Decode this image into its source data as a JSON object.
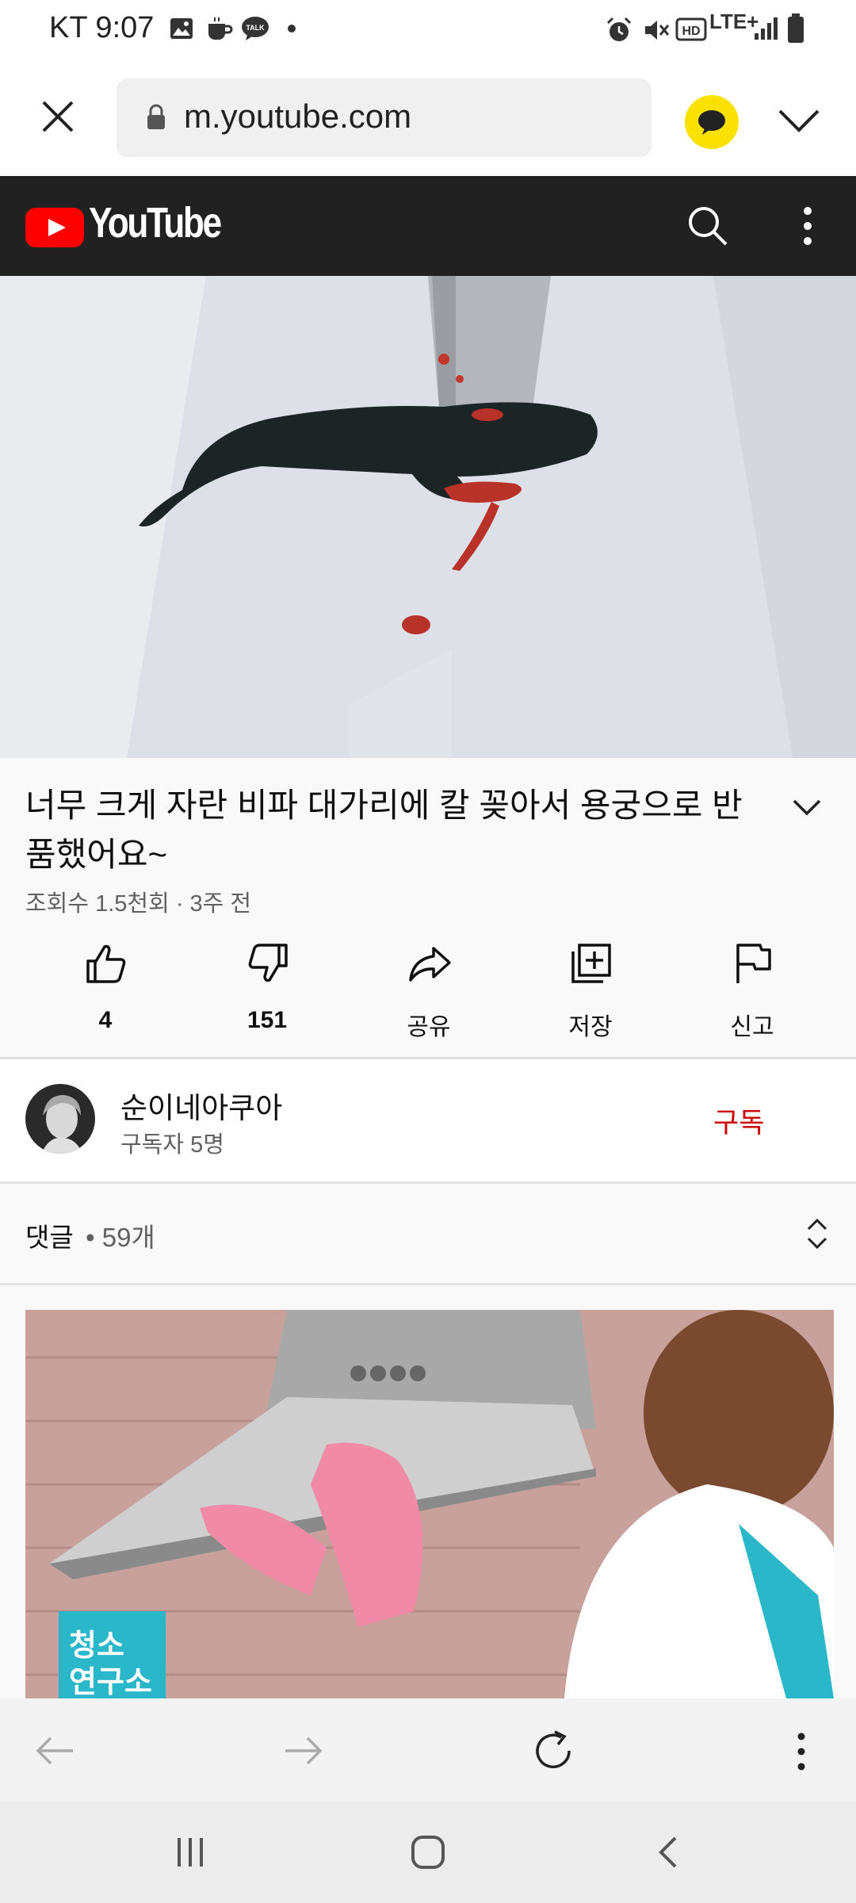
{
  "status_bar": {
    "carrier_time": "KT 9:07",
    "talk_badge": "TALK",
    "network": "LTE+",
    "hd": "HD"
  },
  "browser": {
    "url": "m.youtube.com"
  },
  "youtube": {
    "logo_text": "YouTube"
  },
  "video": {
    "title": "너무 크게 자란 비파 대가리에 칼 꽂아서 용궁으로 반품했어요~",
    "meta": "조회수 1.5천회 · 3주 전",
    "actions": [
      {
        "icon": "like-icon",
        "label": "4"
      },
      {
        "icon": "dislike-icon",
        "label": "151"
      },
      {
        "icon": "share-icon",
        "label": "공유"
      },
      {
        "icon": "save-icon",
        "label": "저장"
      },
      {
        "icon": "report-icon",
        "label": "신고"
      }
    ]
  },
  "channel": {
    "name": "순이네아쿠아",
    "subscribers": "구독자 5명",
    "subscribe_label": "구독"
  },
  "comments": {
    "label": "댓글",
    "count": "• 59개"
  },
  "ad": {
    "text_line1": "청소",
    "text_line2": "연구소"
  },
  "colors": {
    "accent": "#cc0000",
    "yt_header": "#212121",
    "kakao": "#fae100",
    "ad_teal": "#2ab7c9"
  }
}
